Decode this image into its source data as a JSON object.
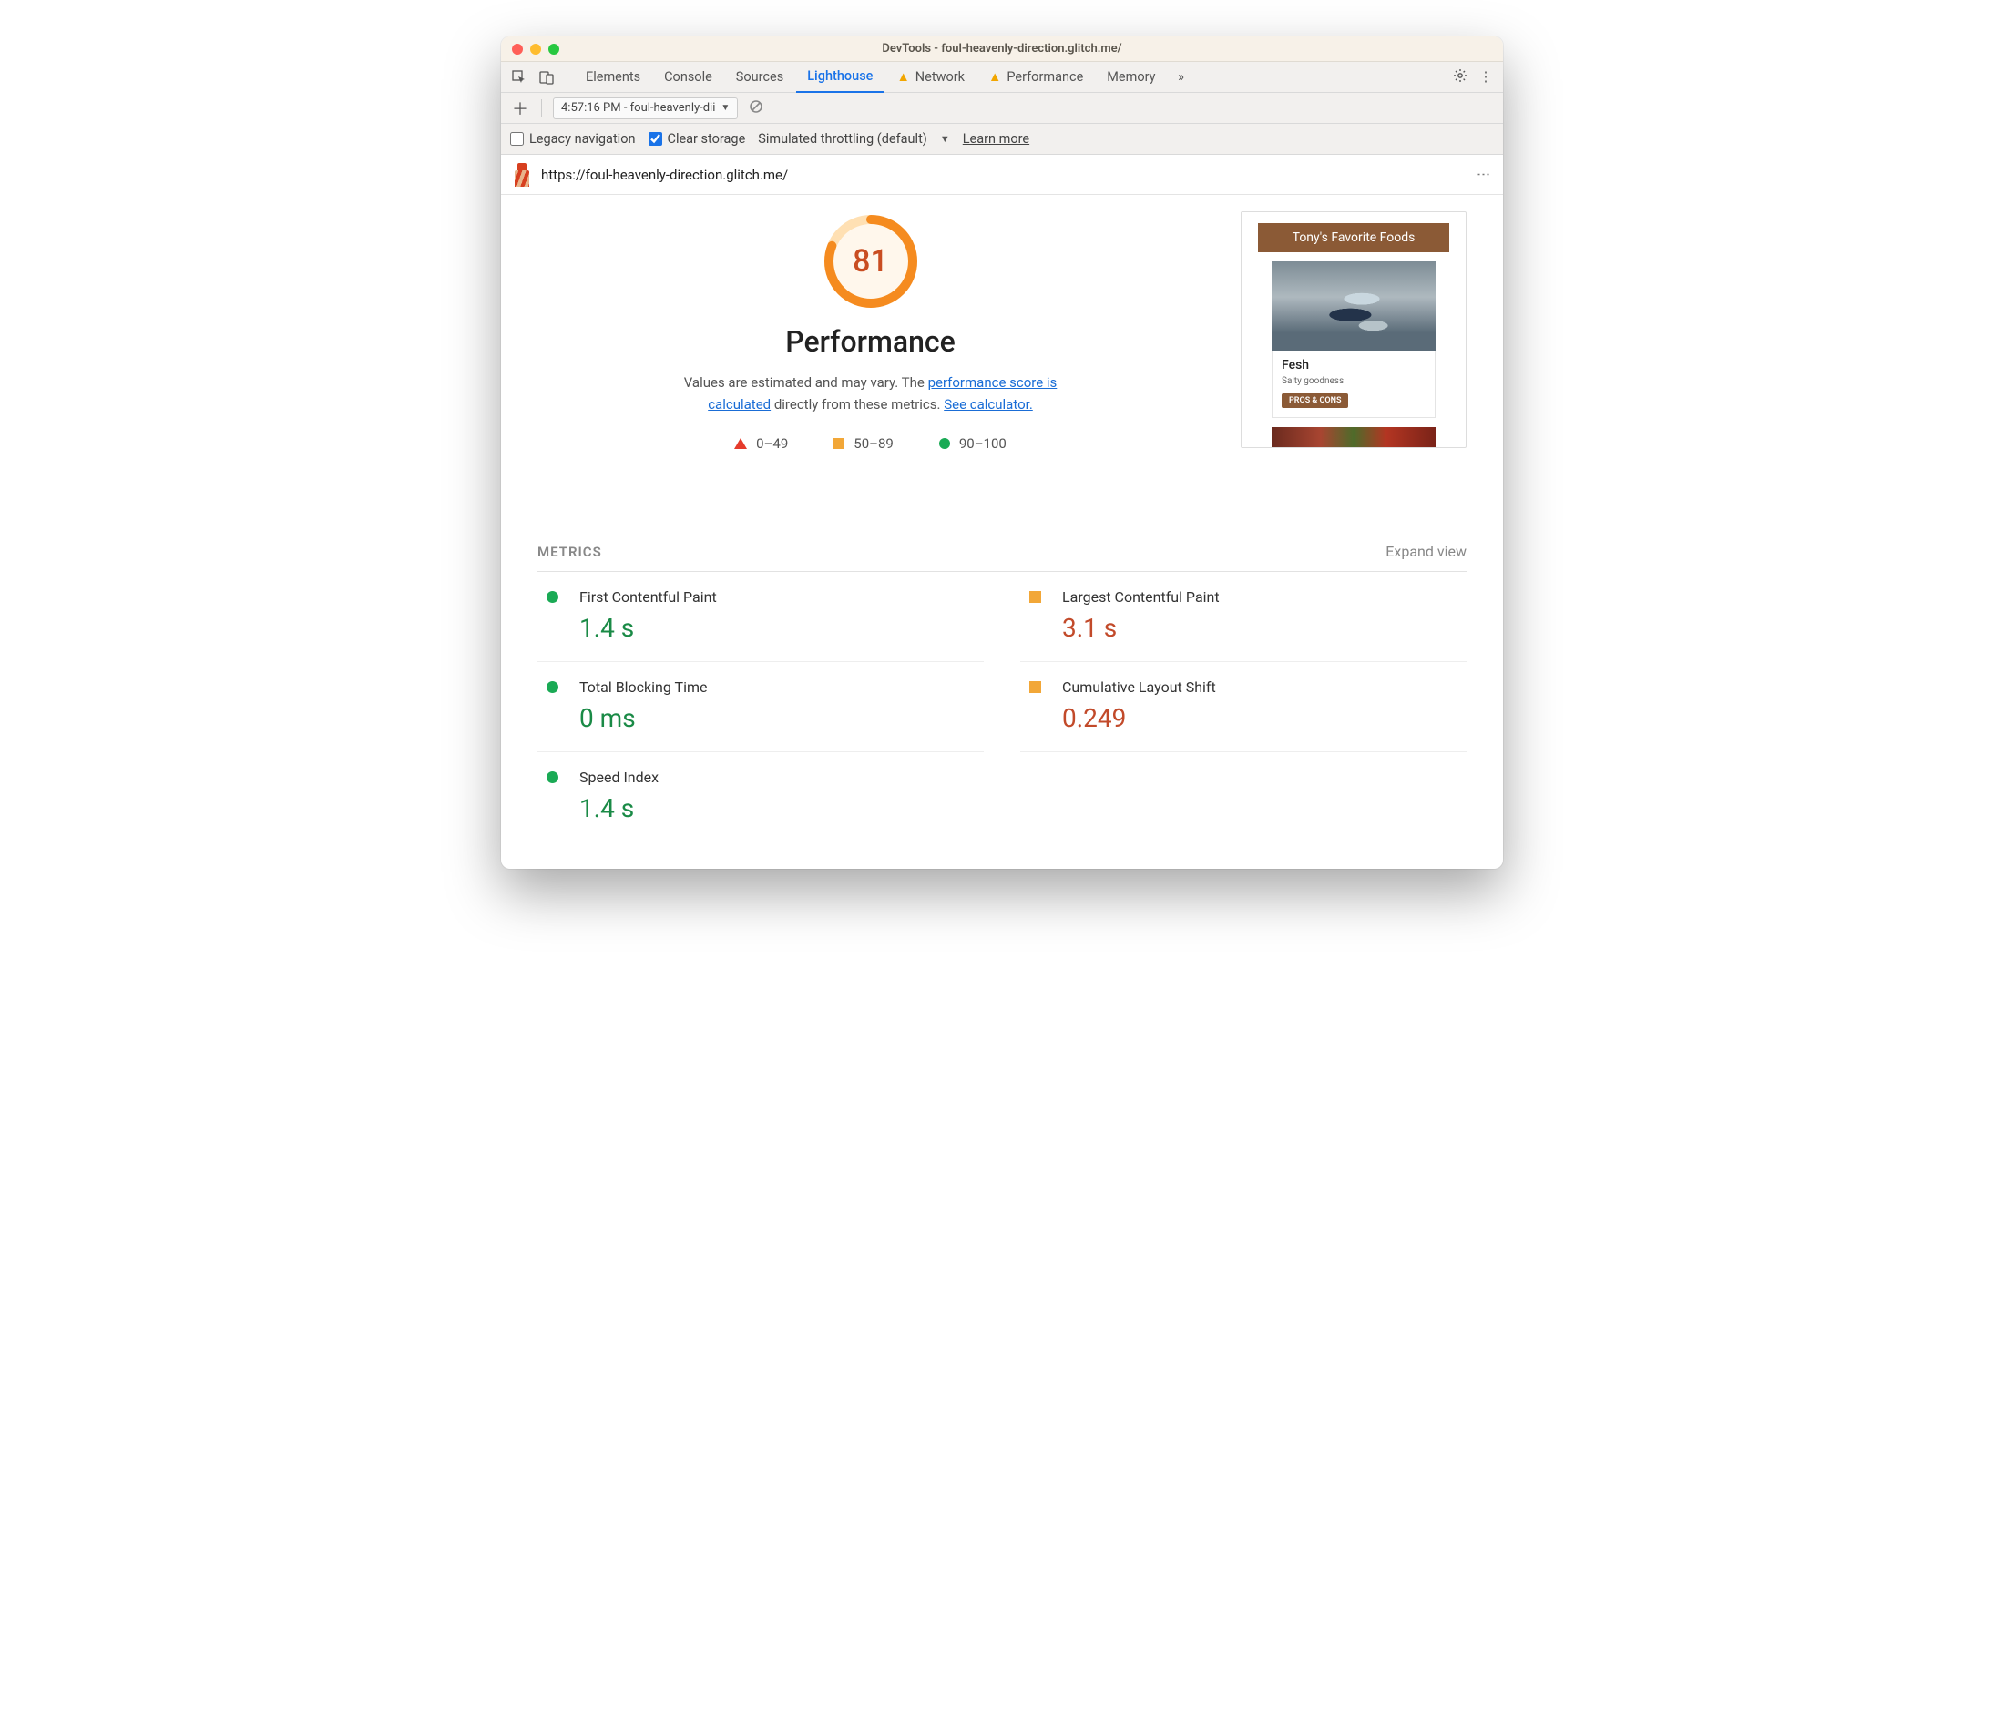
{
  "window": {
    "title": "DevTools - foul-heavenly-direction.glitch.me/"
  },
  "tabs": {
    "items": [
      "Elements",
      "Console",
      "Sources",
      "Lighthouse",
      "Network",
      "Performance",
      "Memory"
    ],
    "active": "Lighthouse",
    "warn": [
      "Network",
      "Performance"
    ]
  },
  "subbar": {
    "dropdown": "4:57:16 PM - foul-heavenly-dii"
  },
  "options": {
    "legacy_label": "Legacy navigation",
    "clear_label": "Clear storage",
    "throttle_label": "Simulated throttling (default)",
    "learn_label": "Learn more"
  },
  "report": {
    "url": "https://foul-heavenly-direction.glitch.me/",
    "score": "81",
    "title": "Performance",
    "desc_pre": "Values are estimated and may vary. The ",
    "link1": "performance score is calculated",
    "desc_mid": " directly from these metrics. ",
    "link2": "See calculator.",
    "legend": {
      "a": "0–49",
      "b": "50–89",
      "c": "90–100"
    }
  },
  "preview": {
    "header": "Tony's Favorite Foods",
    "card_title": "Fesh",
    "card_sub": "Salty goodness",
    "btn": "PROS & CONS"
  },
  "metrics": {
    "heading": "METRICS",
    "expand": "Expand view",
    "items": [
      {
        "name": "First Contentful Paint",
        "value": "1.4 s",
        "status": "green"
      },
      {
        "name": "Largest Contentful Paint",
        "value": "3.1 s",
        "status": "orange"
      },
      {
        "name": "Total Blocking Time",
        "value": "0 ms",
        "status": "green"
      },
      {
        "name": "Cumulative Layout Shift",
        "value": "0.249",
        "status": "orange"
      },
      {
        "name": "Speed Index",
        "value": "1.4 s",
        "status": "green"
      }
    ]
  },
  "colors": {
    "accent": "#1a73e8",
    "good": "#1aaa55",
    "avg": "#f2a738",
    "bad": "#e53b2c",
    "score": "#c94d21"
  }
}
